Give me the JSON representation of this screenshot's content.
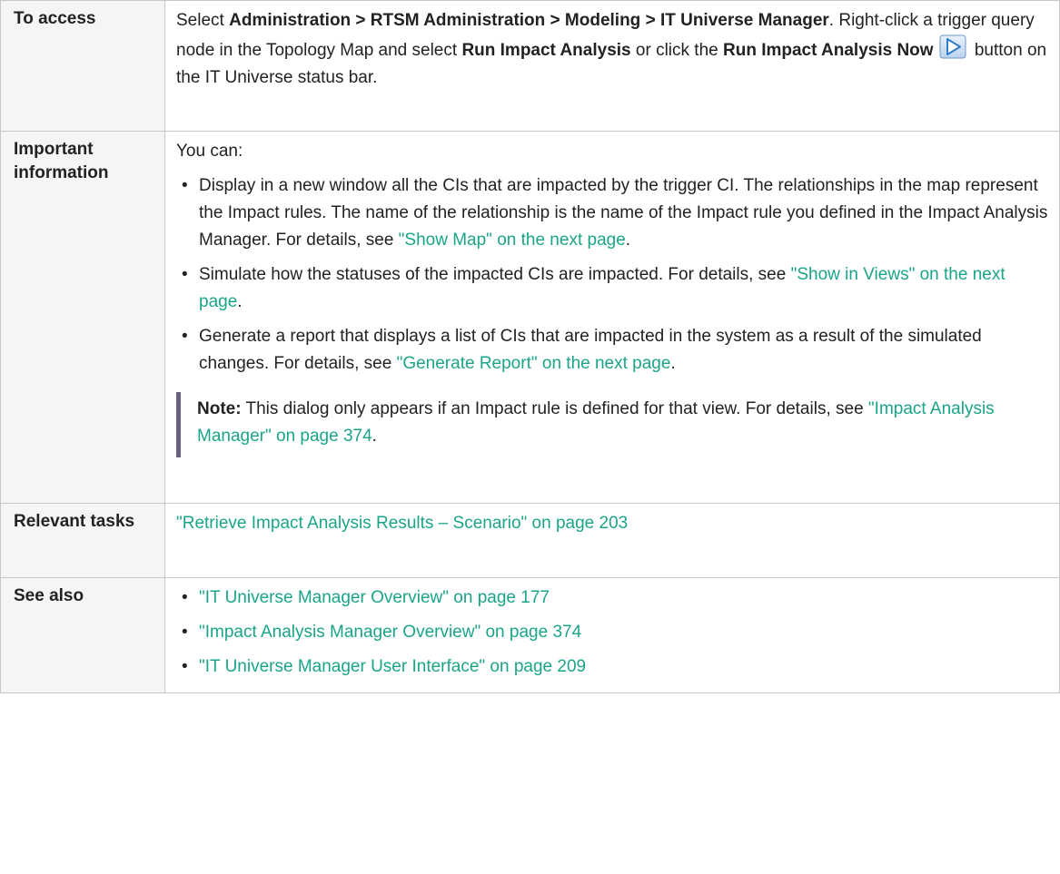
{
  "rows": {
    "access": {
      "label": "To access",
      "p1_select": "Select ",
      "path_bold": "Administration > RTSM Administration > Modeling > IT Universe Manager",
      "p1_rest": ". Right-click a trigger query node in the Topology Map and select ",
      "run_bold": "Run Impact Analysis",
      "or_click": " or click the ",
      "run_now_bold": "Run Impact Analysis Now",
      "button_rest": " button on the IT Universe status bar.",
      "icon": "play-arrow-icon"
    },
    "important": {
      "label": "Important information",
      "intro": "You can:",
      "bullets": [
        {
          "text": "Display in a new window all the CIs that are impacted by the trigger CI. The relationships in the map represent the Impact rules. The name of the relationship is the name of the Impact rule you defined in the Impact Analysis Manager. For details, see ",
          "link": "\"Show Map\" on the next page",
          "end": "."
        },
        {
          "text": "Simulate how the statuses of the impacted CIs are impacted. For details, see ",
          "link": "\"Show in Views\" on the next page",
          "end": "."
        },
        {
          "text": "Generate a report that displays a list of CIs that are impacted in the system as a result of the simulated changes. For details, see ",
          "link": "\"Generate Report\" on the next page",
          "end": "."
        }
      ],
      "note": {
        "label": "Note:",
        "text": " This dialog only appears if an Impact rule is defined for that view. For details, see ",
        "link": "\"Impact Analysis Manager\" on page 374",
        "end": "."
      }
    },
    "tasks": {
      "label": "Relevant tasks",
      "link": "\"Retrieve Impact Analysis Results – Scenario\" on page 203"
    },
    "see_also": {
      "label": "See also",
      "links": [
        "\"IT Universe Manager Overview\" on page 177",
        "\"Impact Analysis Manager Overview\" on page 374",
        "\"IT Universe Manager User Interface\" on page 209"
      ]
    }
  },
  "colors": {
    "link": "#1aa589",
    "label_bg": "#f5f5f5",
    "border": "#c8c8c8",
    "note_bar": "#6b5f7e"
  }
}
